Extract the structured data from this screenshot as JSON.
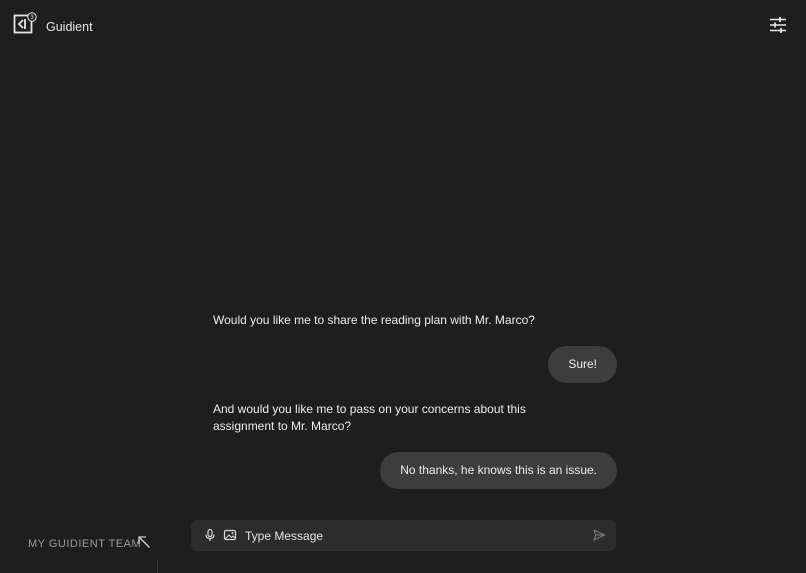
{
  "header": {
    "app_name": "Guidient",
    "logo_icon": "guidient-logo-icon",
    "logo_badge": "3",
    "settings_icon": "sliders-icon"
  },
  "chat": {
    "messages": [
      {
        "from": "bot",
        "text": "Would you like me to share the reading plan with Mr. Marco?"
      },
      {
        "from": "user",
        "text": "Sure!"
      },
      {
        "from": "bot",
        "text": "And would you like me to pass on your concerns about this assignment to Mr. Marco?"
      },
      {
        "from": "user",
        "text": "No thanks, he knows this is an issue."
      }
    ]
  },
  "composer": {
    "placeholder": "Type Message",
    "mic_icon": "microphone-icon",
    "image_icon": "image-icon",
    "send_icon": "send-icon"
  },
  "footer": {
    "team_label": "MY GUIDIENT TEAM",
    "team_icon": "arrow-up-left-icon"
  },
  "colors": {
    "background": "#1e1e1e",
    "bubble": "#3d3d3d",
    "composer": "#2c2c2c",
    "muted_text": "#9a9a9a"
  }
}
